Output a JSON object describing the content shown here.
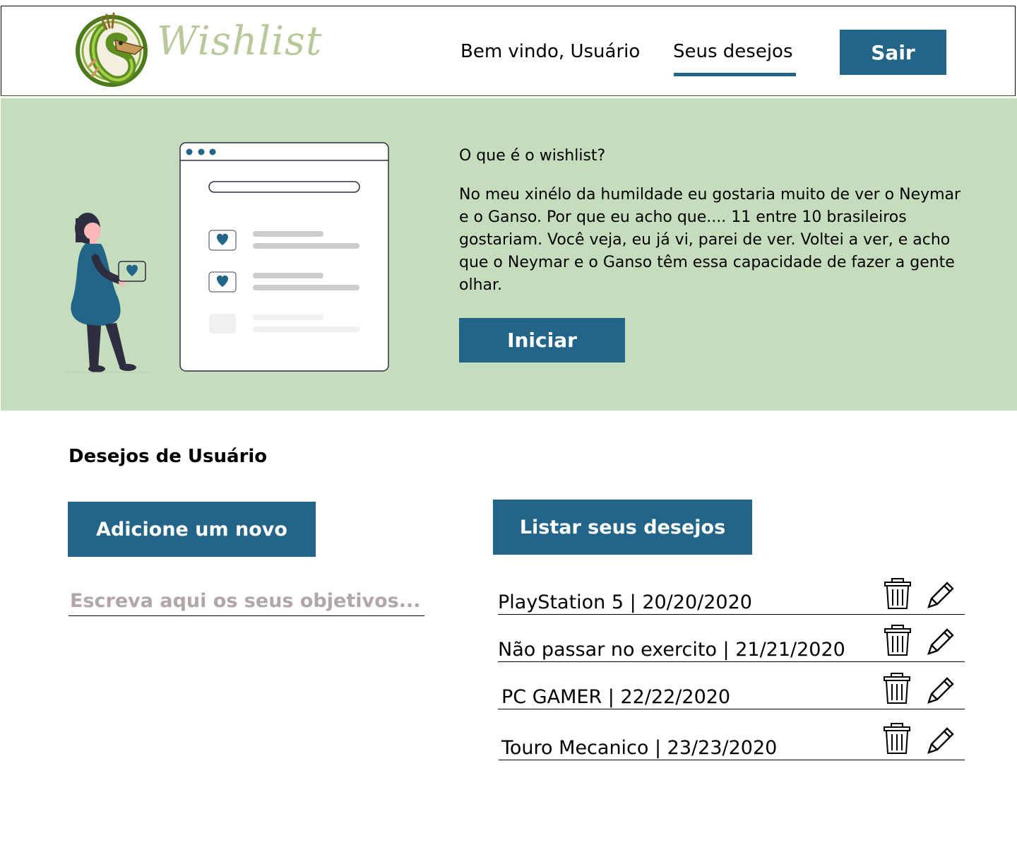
{
  "header": {
    "logo_text": "Wishlist",
    "welcome": "Bem vindo, Usuário",
    "nav_wishes": "Seus desejos",
    "logout": "Sair"
  },
  "hero": {
    "question": "O que é o wishlist?",
    "description": "No meu xinélo da humildade eu gostaria muito de ver o Neymar e o Ganso. Por que eu acho que.... 11 entre 10 brasileiros gostariam. Você veja, eu já vi, parei de ver. Voltei a ver, e acho que o Neymar e o Ganso têm essa capacidade de fazer a gente olhar.",
    "start": "Iniciar"
  },
  "wishes_section": {
    "title": "Desejos de Usuário",
    "add_button": "Adicione um novo",
    "list_button": "Listar seus desejos",
    "input_placeholder": "Escreva aqui os seus objetivos...",
    "items": [
      {
        "label": "PlayStation 5 | 20/20/2020"
      },
      {
        "label": "Não passar no exercito | 21/21/2020"
      },
      {
        "label": "PC GAMER | 22/22/2020"
      },
      {
        "label": "Touro Mecanico | 23/23/2020"
      }
    ]
  },
  "colors": {
    "primary": "#226588",
    "hero_background": "#c5ddbd",
    "logo_text": "#b7c99a"
  },
  "icons": [
    "dragon-logo-icon",
    "heart-icon",
    "trash-icon",
    "pencil-icon"
  ]
}
